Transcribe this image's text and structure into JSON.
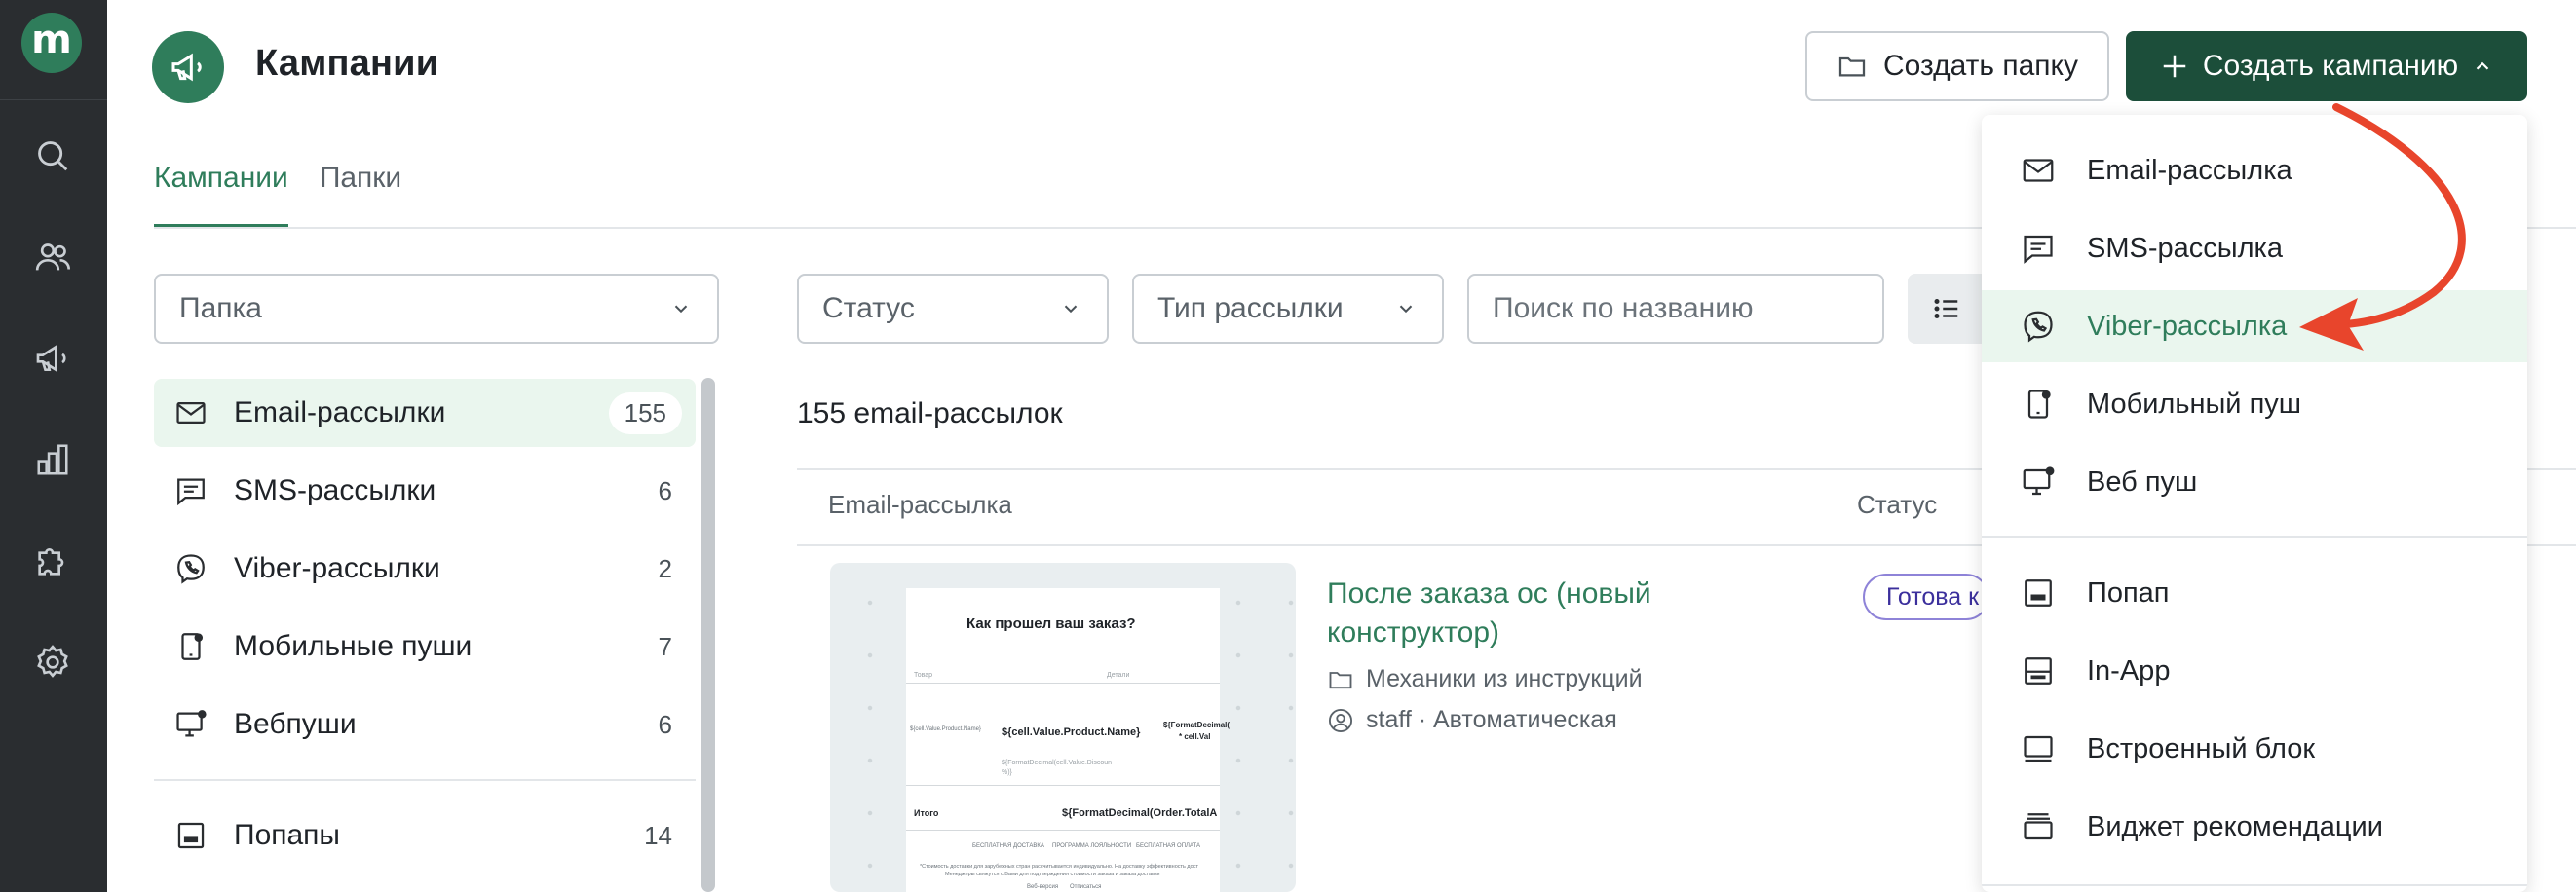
{
  "rail": {
    "logo": "m",
    "items": [
      "search-icon",
      "users-icon",
      "megaphone-icon",
      "bar-chart-icon",
      "puzzle-icon",
      "gear-icon"
    ]
  },
  "header": {
    "title": "Кампании",
    "create_folder_label": "Создать папку",
    "create_campaign_label": "Создать кампанию"
  },
  "tabs": [
    {
      "label": "Кампании",
      "active": true
    },
    {
      "label": "Папки",
      "active": false
    }
  ],
  "filters": {
    "folder_placeholder": "Папка",
    "status_placeholder": "Статус",
    "type_placeholder": "Тип рассылки",
    "search_placeholder": "Поиск по названию"
  },
  "folders": [
    {
      "label": "Email-рассылки",
      "count": "155",
      "icon": "mail-icon",
      "active": true
    },
    {
      "label": "SMS-рассылки",
      "count": "6",
      "icon": "sms-icon",
      "active": false
    },
    {
      "label": "Viber-рассылки",
      "count": "2",
      "icon": "viber-icon",
      "active": false
    },
    {
      "label": "Мобильные пуши",
      "count": "7",
      "icon": "mobile-push-icon",
      "active": false
    },
    {
      "label": "Вебпуши",
      "count": "6",
      "icon": "web-push-icon",
      "active": false
    },
    {
      "label": "Попапы",
      "count": "14",
      "icon": "popup-icon",
      "active": false
    }
  ],
  "main": {
    "count_title": "155 email-рассылок",
    "columns": [
      "Email-рассылка",
      "Статус"
    ],
    "rows": [
      {
        "name": "После заказа ос (новый конструктор)",
        "folder": "Механики из инструкций",
        "author": "staff · Автоматическая",
        "status": "Готова к",
        "preview": {
          "heading": "Как прошел ваш заказ?",
          "col_left": "Товар",
          "col_right": "Детали",
          "img_alt": "${cell.Value.Product.Name}",
          "product_name": "${cell.Value.Product.Name}",
          "price_expr": "${FormatDecimal(",
          "value_expr": "* cell.Val",
          "discount_expr": "${FormatDecimal(cell.Value.Discoun",
          "discount_pct": "%)}",
          "total_label": "Итого",
          "total_value": "${FormatDecimal(Order.TotalA",
          "footer_links": [
            "БЕСПЛАТНАЯ ДОСТАВКА",
            "ПРОГРАММА ЛОЯЛЬНОСТИ",
            "БЕСПЛАТНАЯ ОПЛАТА"
          ],
          "fine_print_1": "*Стоимость доставки для зарубежных стран рассчитывается индивидуально. На доставку эффективность дост",
          "fine_print_2": "Менеджеры свяжутся с Вами для подтверждения стоимости заказа и заказа доставки",
          "bottom_links": [
            "Веб-версия",
            "Отписаться"
          ]
        }
      }
    ]
  },
  "dropdown": {
    "items": [
      {
        "label": "Email-рассылка",
        "icon": "mail-icon"
      },
      {
        "label": "SMS-рассылка",
        "icon": "sms-icon"
      },
      {
        "label": "Viber-рассылка",
        "icon": "viber-icon",
        "active": true
      },
      {
        "label": "Мобильный пуш",
        "icon": "mobile-push-icon"
      },
      {
        "label": "Веб пуш",
        "icon": "web-push-icon"
      },
      {
        "label": "Попап",
        "icon": "popup-icon"
      },
      {
        "label": "In-App",
        "icon": "inapp-icon"
      },
      {
        "label": "Встроенный блок",
        "icon": "embedded-block-icon"
      },
      {
        "label": "Виджет рекомендации",
        "icon": "recommendation-widget-icon"
      }
    ]
  },
  "colors": {
    "brand_green": "#2f7d5b",
    "button_dark_green": "#1c4e3a",
    "rail_bg": "#2a2d30",
    "active_bg": "#eaf6ee",
    "annotation_arrow": "#e8452c",
    "status_badge_border": "#8e83d8"
  }
}
